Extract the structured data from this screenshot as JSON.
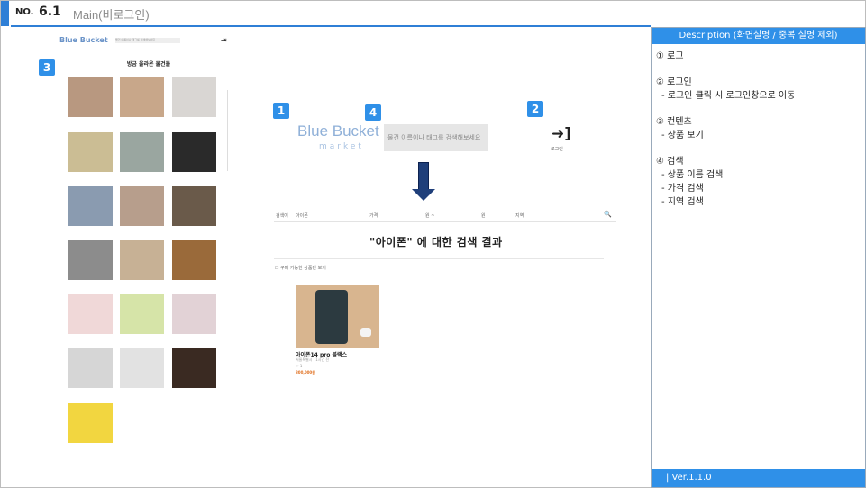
{
  "header": {
    "no_label": "NO.",
    "number": "6.1",
    "title": "Main(비로그인)"
  },
  "panel": {
    "heading": "Description (화면설명 / 중복 설명 제외)",
    "sections": [
      {
        "title": "① 로고",
        "items": []
      },
      {
        "title": "② 로그인",
        "items": [
          "- 로그인 클릭 시 로그인창으로 이동"
        ]
      },
      {
        "title": "③ 컨텐츠",
        "items": [
          "- 상품 보기"
        ]
      },
      {
        "title": "④ 검색",
        "items": [
          "- 상품 이름 검색",
          "- 가격 검색",
          "- 지역 검색"
        ]
      }
    ],
    "footer": "| Ver.1.1.0"
  },
  "badges": [
    "1",
    "2",
    "3",
    "4"
  ],
  "main_page": {
    "logo": "Blue Bucket",
    "logo_sub": "market",
    "search_placeholder": "물건 이름이나 태그를 검색해보세요",
    "login_label": "로그인",
    "list_title": "방금 올라온 물건들"
  },
  "search_page": {
    "filter": {
      "name_label": "검색어",
      "name_value": "아이폰",
      "price_label": "가격",
      "price_sep": "원 ~",
      "price_unit": "원",
      "region_label": "지역"
    },
    "result_title": "\"아이폰\" 에 대한 검색 결과",
    "available_only": "구매 가능한 상품만 보기",
    "result": {
      "name": "아이폰14 pro 블랙스",
      "location": "서울특별시 · 1시간 전",
      "likes": "♡ 1",
      "price": "800,000원"
    }
  },
  "colors": {
    "accent": "#2f90e8",
    "arrow": "#1f3f7a"
  },
  "icons": {
    "login": "login-icon",
    "arrow": "down-arrow-icon"
  }
}
